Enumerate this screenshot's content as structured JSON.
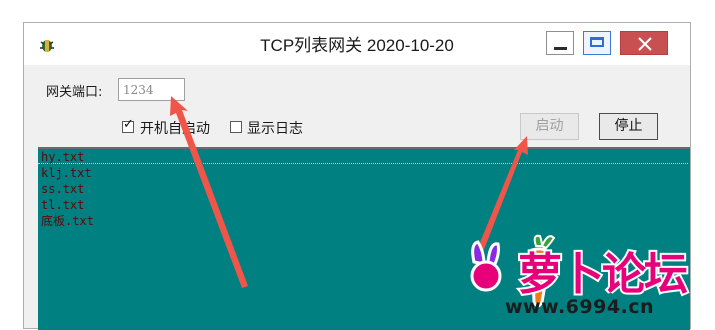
{
  "window": {
    "title": "TCP列表网关 2020-10-20",
    "icons": {
      "app": "bug-app-icon",
      "minimize": "minimize-icon",
      "maximize": "maximize-icon",
      "close": "close-icon"
    }
  },
  "form": {
    "port_label": "网关端口:",
    "port_value": "1234",
    "autostart_label": "开机自启动",
    "autostart_checked": true,
    "check_glyph": "✓",
    "showlog_label": "显示日志",
    "showlog_checked": false,
    "start_button": "启动",
    "stop_button": "停止"
  },
  "list": {
    "items": [
      "hy.txt",
      "klj.txt",
      "ss.txt",
      "tl.txt",
      "底板.txt"
    ],
    "background": "#008080",
    "text_color": "#5a0808"
  },
  "watermark": {
    "text": "萝卜论坛",
    "domain": "www.6994.cn",
    "color": "#e6007a"
  },
  "annotations": {
    "arrow_color": "#f0554a"
  }
}
